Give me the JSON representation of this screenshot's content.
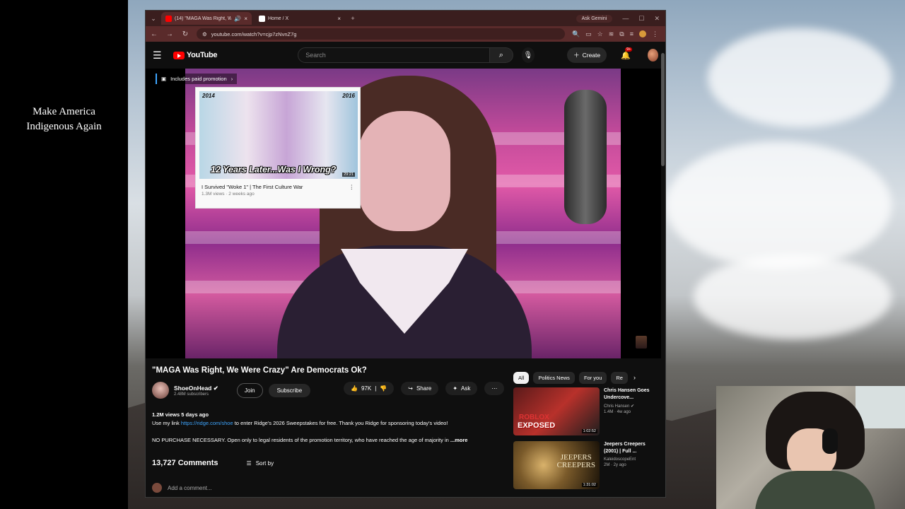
{
  "overlay": {
    "caption_line1": "Make America",
    "caption_line2": "Indigenous Again"
  },
  "browser": {
    "tabs": [
      {
        "title": "(14) \"MAGA Was Right, We",
        "active": true
      },
      {
        "title": "Home / X",
        "active": false
      }
    ],
    "new_tab_glyph": "+",
    "gemini_label": "Ask Gemini",
    "url": "youtube.com/watch?v=cjp7zNvnZ7g"
  },
  "youtube": {
    "logo_text": "YouTube",
    "search_placeholder": "Search",
    "create_label": "Create",
    "notification_count": "9+"
  },
  "player": {
    "paid_promotion": "Includes paid promotion",
    "card": {
      "year_left": "2014",
      "year_right": "2016",
      "thumb_text": "12 Years Later...Was I Wrong?",
      "duration": "29:21",
      "title": "I Survived \"Woke 1\" | The First Culture War",
      "meta": "1.3M views · 2 weeks ago"
    }
  },
  "video": {
    "title": "\"MAGA Was Right, We Were Crazy\" Are Democrats Ok?",
    "channel_name": "ShoeOnHead",
    "subscribers": "2.48M subscribers",
    "join_label": "Join",
    "subscribe_label": "Subscribe",
    "likes": "97K",
    "share_label": "Share",
    "ask_label": "Ask",
    "views_date": "1.2M views  5 days ago",
    "desc_line1_pre": "Use my link ",
    "desc_link": "https://ridge.com/shoe",
    "desc_line1_post": " to enter Ridge's 2026 Sweepstakes for free. Thank you Ridge for sponsoring today's video!",
    "desc_line2": "NO PURCHASE NECESSARY. Open only to legal residents of the promotion territory, who have reached the age of majority in",
    "more_label": "...more",
    "comments_count": "13,727 Comments",
    "sort_label": "Sort by",
    "add_comment": "Add a comment..."
  },
  "recommendations": {
    "chips": [
      "All",
      "Politics News",
      "For you",
      "Re"
    ],
    "items": [
      {
        "title": "Chris Hansen Goes Undercove...",
        "channel": "Chris Hansen",
        "meta": "1.4M · 4w ago",
        "duration": "1:02:52",
        "thumb_line1": "ROBLOX",
        "thumb_line2": "EXPOSED"
      },
      {
        "title": "Jeepers Creepers (2001) | Full ...",
        "channel": "KaleidoscopeEnt",
        "meta": "2M · 2y ago",
        "duration": "1:31:02",
        "thumb_line1": "JEEPERS",
        "thumb_line2": "CREEPERS"
      }
    ]
  }
}
